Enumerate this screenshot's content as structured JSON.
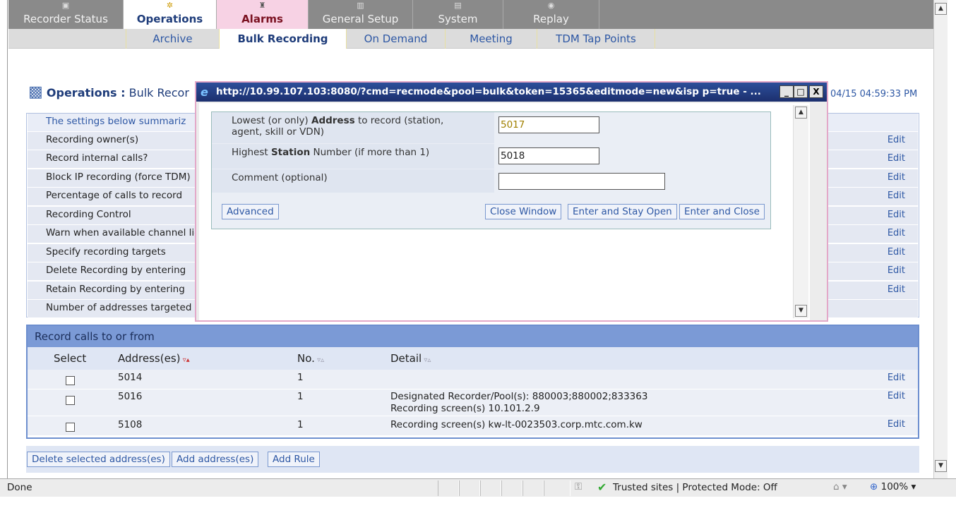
{
  "tabs": [
    {
      "label": "Recorder Status",
      "icon": "monitor-icon"
    },
    {
      "label": "Operations",
      "icon": "gears-icon"
    },
    {
      "label": "Alarms",
      "icon": "alarm-icon"
    },
    {
      "label": "General Setup",
      "icon": "setup-icon"
    },
    {
      "label": "System",
      "icon": "system-icon"
    },
    {
      "label": "Replay",
      "icon": "replay-icon"
    }
  ],
  "subtabs": [
    "Archive",
    "Bulk Recording",
    "On Demand",
    "Meeting",
    "TDM Tap Points"
  ],
  "page": {
    "title_bold": "Operations :",
    "title_rest": " Bulk Recor",
    "timestamp": "04/15 04:59:33 PM"
  },
  "settings": {
    "header": "The settings below summariz",
    "rows": [
      "Recording owner(s)",
      "Record internal calls?",
      "Block IP recording (force TDM)",
      "Percentage of calls to record",
      "Recording Control",
      "Warn when available channel lice",
      "Specify recording targets",
      "Delete Recording by entering",
      "Retain Recording by entering",
      "Number of addresses targeted (i"
    ],
    "edit": "Edit"
  },
  "record": {
    "title": "Record calls to or from",
    "columns": [
      "Select",
      "Address(es)",
      "No.",
      "Detail"
    ],
    "rows": [
      {
        "address": "5014",
        "no": "1",
        "detail1": "",
        "detail2": ""
      },
      {
        "address": "5016",
        "no": "1",
        "detail1": "Designated Recorder/Pool(s): 880003;880002;833363",
        "detail2": "Recording screen(s) 10.101.2.9"
      },
      {
        "address": "5108",
        "no": "1",
        "detail1": "Recording screen(s) kw-lt-0023503.corp.mtc.com.kw",
        "detail2": ""
      }
    ]
  },
  "buttons": {
    "delete": "Delete selected address(es)",
    "add": "Add address(es)",
    "rule": "Add Rule"
  },
  "popup": {
    "title": "http://10.99.107.103:8080/?cmd=recmode&pool=bulk&token=15365&editmode=new&isp   p=true - ...",
    "low_pre": "Lowest (or only) ",
    "low_bold": "Address",
    "low_post": " to record (station, agent, skill or VDN)",
    "low_value": "5017",
    "high_pre": "Highest ",
    "high_bold": "Station",
    "high_post": " Number (if more than 1)",
    "high_value": "5018",
    "comment_label": "Comment (optional)",
    "comment_value": "",
    "advanced": "Advanced",
    "close": "Close Window",
    "stay": "Enter and Stay Open",
    "enter_close": "Enter and Close"
  },
  "status": {
    "left": "Done",
    "zone": "Trusted sites | Protected Mode: Off",
    "zoom": "100%"
  }
}
